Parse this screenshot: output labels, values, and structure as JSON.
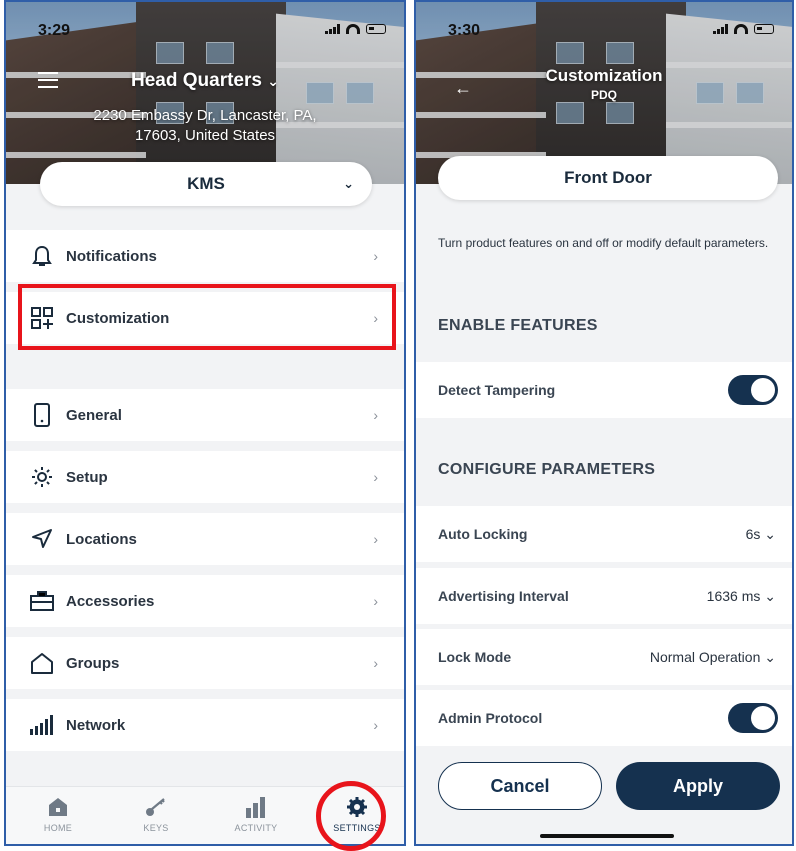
{
  "left_screen": {
    "status": {
      "time": "3:29"
    },
    "header": {
      "location_name": "Head Quarters",
      "location_chevron": "⌄",
      "address_line1": "2230 Embassy Dr, Lancaster, PA,",
      "address_line2": "17603, United States"
    },
    "site_selector": {
      "value": "KMS"
    },
    "menu": [
      {
        "label": "Notifications",
        "icon": "bell-icon"
      },
      {
        "label": "Customization",
        "icon": "grid-plus-icon"
      },
      {
        "label": "General",
        "icon": "phone-icon"
      },
      {
        "label": "Setup",
        "icon": "gear-icon"
      },
      {
        "label": "Locations",
        "icon": "navigation-arrow-icon"
      },
      {
        "label": "Accessories",
        "icon": "toolbox-icon"
      },
      {
        "label": "Groups",
        "icon": "house-icon"
      },
      {
        "label": "Network",
        "icon": "signal-bars-icon"
      }
    ],
    "tabs": [
      {
        "label": "HOME",
        "icon": "home-icon"
      },
      {
        "label": "KEYS",
        "icon": "key-icon"
      },
      {
        "label": "ACTIVITY",
        "icon": "bar-chart-icon"
      },
      {
        "label": "SETTINGS",
        "icon": "gear-icon"
      }
    ],
    "highlight_color": "#e8141b"
  },
  "right_screen": {
    "status": {
      "time": "3:30"
    },
    "header": {
      "title": "Customization",
      "subtitle": "PDQ"
    },
    "door_selector": {
      "value": "Front Door"
    },
    "description": "Turn product features on and off or modify default parameters.",
    "enable_features": {
      "title": "ENABLE FEATURES",
      "items": [
        {
          "label": "Detect Tampering",
          "enabled": true
        }
      ]
    },
    "configure_parameters": {
      "title": "CONFIGURE PARAMETERS",
      "items": [
        {
          "label": "Auto Locking",
          "value": "6s"
        },
        {
          "label": "Advertising Interval",
          "value": "1636 ms"
        },
        {
          "label": "Lock Mode",
          "value": "Normal Operation"
        }
      ]
    },
    "admin_protocol": {
      "label": "Admin Protocol",
      "enabled": true
    },
    "buttons": {
      "cancel": "Cancel",
      "apply": "Apply"
    },
    "accent_color": "#15314f"
  }
}
